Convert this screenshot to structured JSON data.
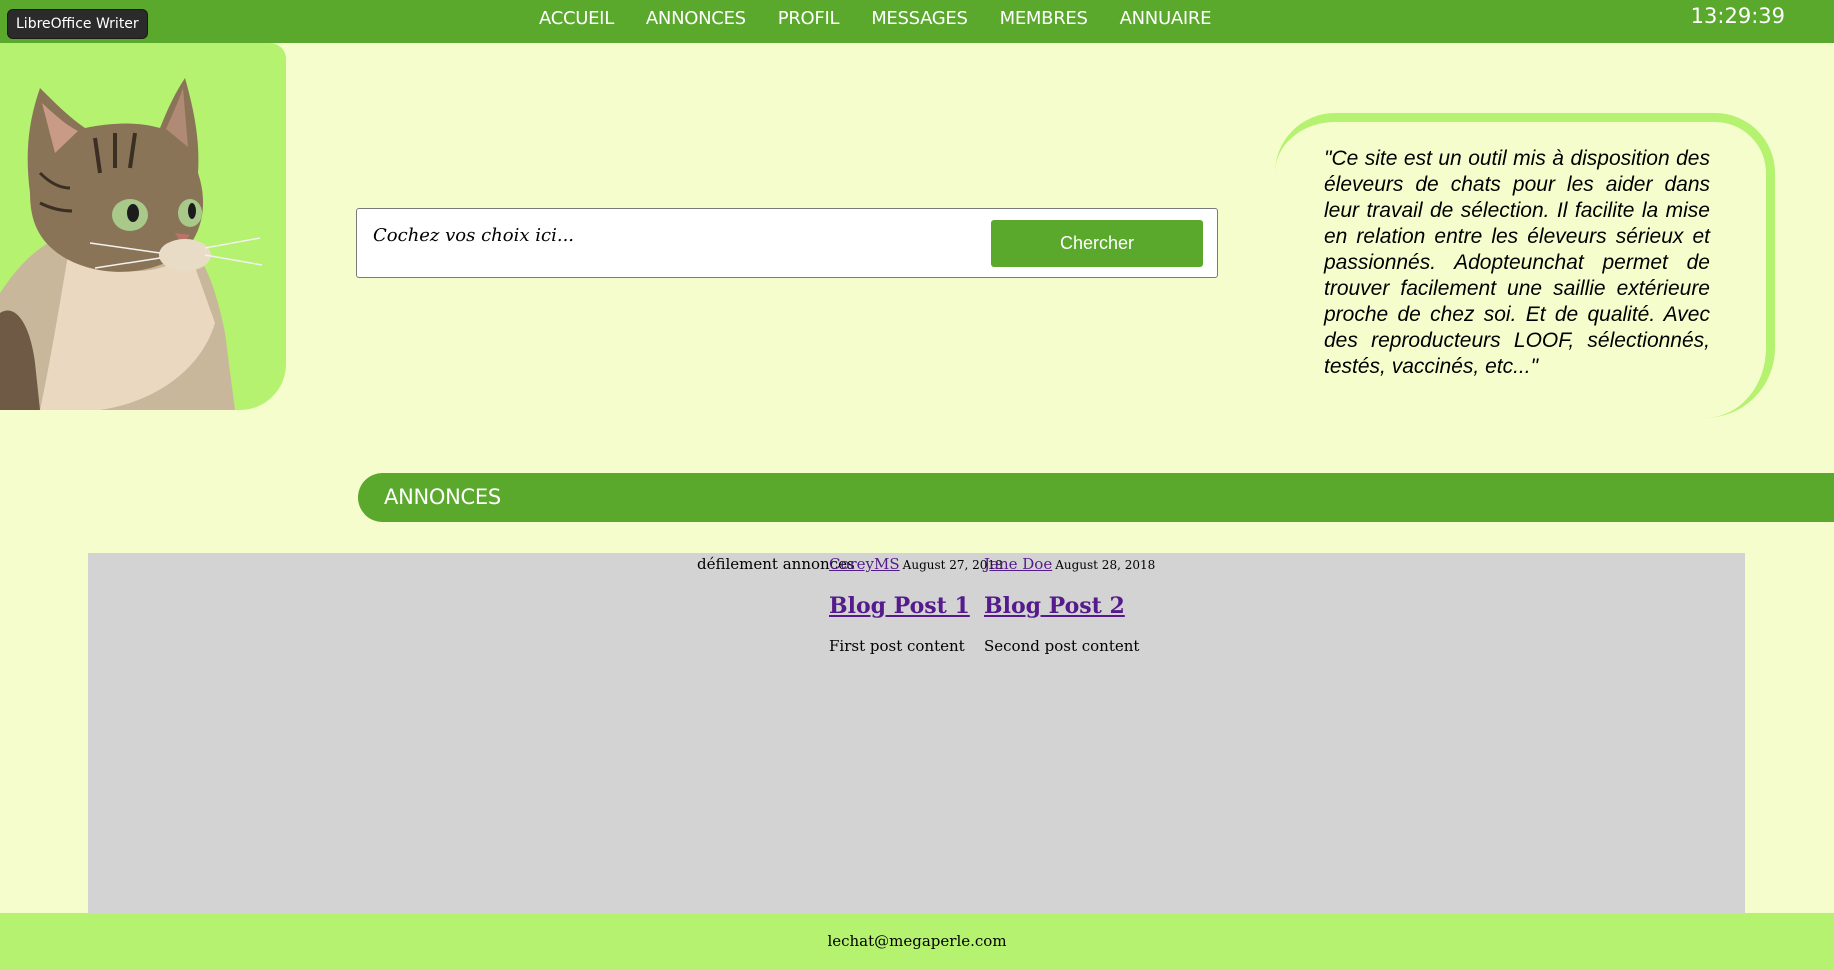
{
  "app_label": "LibreOffice Writer",
  "nav": {
    "items": [
      "ACCUEIL",
      "ANNONCES",
      "PROFIL",
      "MESSAGES",
      "MEMBRES",
      "ANNUAIRE"
    ]
  },
  "clock": "13:29:39",
  "search": {
    "placeholder": "Cochez vos choix ici...",
    "button_label": "Chercher"
  },
  "quote": "\"Ce site est un outil mis à disposition des éleveurs de chats pour les aider dans leur travail de sélection. Il facilite la mise en relation entre les éleveurs sérieux et passionnés. Adopteunchat permet de trouver facilement une saillie extérieure proche de chez soi. Et de qualité. Avec des reproducteurs LOOF, sélectionnés, testés, vaccinés, etc...\"",
  "annonces": {
    "title": "ANNONCES",
    "scroll_label": "défilement annonces",
    "posts": [
      {
        "author": "CoreyMS",
        "date": "August 27, 2018",
        "title": "Blog Post 1",
        "body": "First post content"
      },
      {
        "author": "Jane Doe",
        "date": "August 28, 2018",
        "title": "Blog Post 2",
        "body": "Second post content"
      }
    ]
  },
  "footer": {
    "email": "lechat@megaperle.com"
  },
  "colors": {
    "nav_green": "#5aa82c",
    "light_green": "#b5f26f",
    "page_bg": "#f6fdcd",
    "content_grey": "#d3d3d3",
    "link_purple": "#551a8b"
  }
}
